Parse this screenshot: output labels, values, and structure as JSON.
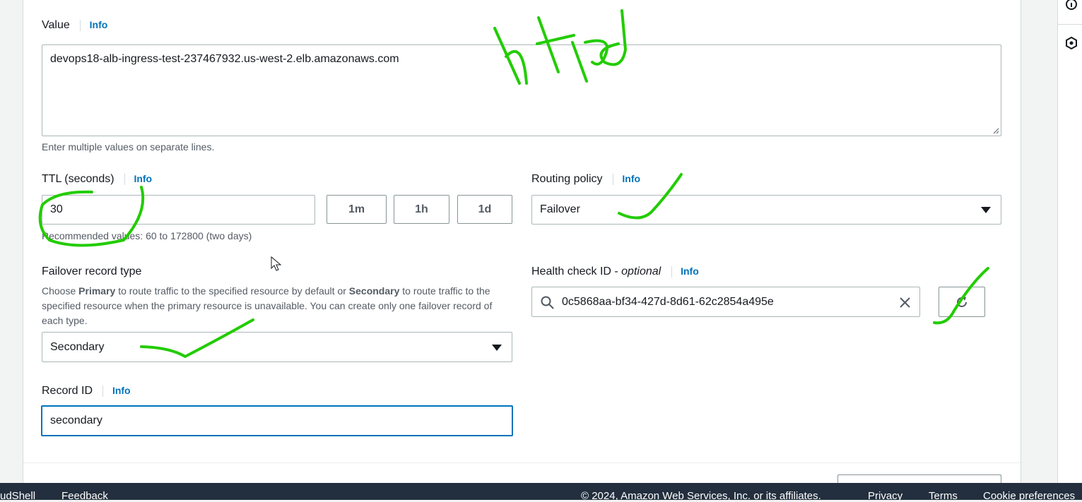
{
  "value_field": {
    "label": "Value",
    "info": "Info",
    "content": "devops18-alb-ingress-test-237467932.us-west-2.elb.amazonaws.com",
    "hint": "Enter multiple values on separate lines."
  },
  "ttl": {
    "label": "TTL (seconds)",
    "info": "Info",
    "value": "30",
    "buttons": [
      "1m",
      "1h",
      "1d"
    ],
    "hint": "Recommended values: 60 to 172800 (two days)"
  },
  "routing_policy": {
    "label": "Routing policy",
    "info": "Info",
    "selected": "Failover"
  },
  "failover_type": {
    "label": "Failover record type",
    "desc_1": "Choose ",
    "desc_primary": "Primary",
    "desc_2": " to route traffic to the specified resource by default or ",
    "desc_secondary": "Secondary",
    "desc_3": " to route traffic to the specified resource when the primary resource is unavailable. You can create only one failover record of each type.",
    "selected": "Secondary"
  },
  "health_check": {
    "label": "Health check ID - ",
    "label_optional": "optional",
    "info": "Info",
    "value": "0c5868aa-bf34-427d-8d61-62c2854a495e"
  },
  "record_id": {
    "label": "Record ID",
    "info": "Info",
    "value": "secondary"
  },
  "annotation": {
    "text": "httpd",
    "color": "#22cc00"
  },
  "footer": {
    "cloudshell": "udShell",
    "feedback": "Feedback",
    "copyright": "© 2024, Amazon Web Services, Inc. or its affiliates.",
    "privacy": "Privacy",
    "terms": "Terms",
    "cookies": "Cookie preferences"
  },
  "colors": {
    "link": "#0073bb",
    "footer_bg": "#232f3e",
    "focus": "#0073bb"
  }
}
